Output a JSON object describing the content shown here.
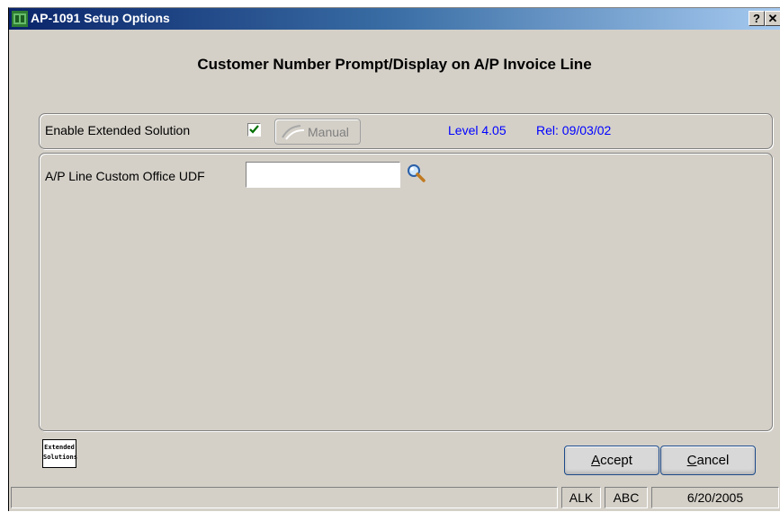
{
  "window": {
    "title": "AP-1091 Setup Options",
    "help_glyph": "?",
    "close_glyph": "✕"
  },
  "header": {
    "text": "Customer Number Prompt/Display on A/P Invoice Line"
  },
  "options": {
    "enable_label": "Enable Extended Solution",
    "enable_checked": true,
    "manual_label": "Manual",
    "level": "Level 4.05",
    "release": "Rel: 09/03/02",
    "udf_label": "A/P Line Custom Office UDF",
    "udf_value": ""
  },
  "logo": {
    "line1": "Extended",
    "line2": "Solutions"
  },
  "buttons": {
    "accept_first": "A",
    "accept_rest": "ccept",
    "cancel_first": "C",
    "cancel_rest": "ancel"
  },
  "status": {
    "message": "",
    "user": "ALK",
    "company": "ABC",
    "date": "6/20/2005"
  },
  "colors": {
    "window_bg": "#d4d0c8",
    "title_start": "#0a246a",
    "info_text": "#0000ff"
  },
  "icons": {
    "app": "setup-app-icon",
    "checkmark": "checkmark-icon",
    "manual": "book-icon",
    "lookup": "magnifier-icon"
  }
}
